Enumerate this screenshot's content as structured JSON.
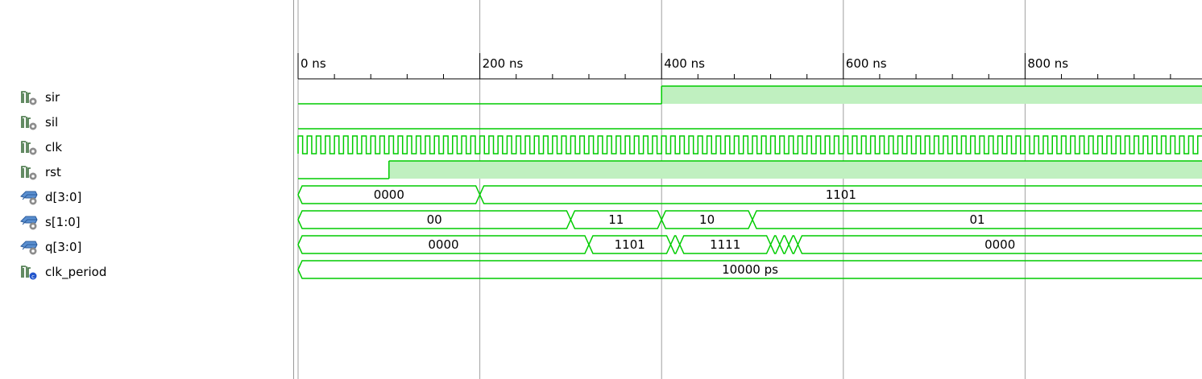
{
  "signals": [
    {
      "name": "sir",
      "icon": "scalar-signal-icon"
    },
    {
      "name": "sil",
      "icon": "scalar-signal-icon"
    },
    {
      "name": "clk",
      "icon": "scalar-signal-icon"
    },
    {
      "name": "rst",
      "icon": "scalar-signal-icon"
    },
    {
      "name": "d[3:0]",
      "icon": "bus-signal-icon"
    },
    {
      "name": "s[1:0]",
      "icon": "bus-signal-icon"
    },
    {
      "name": "q[3:0]",
      "icon": "bus-signal-icon"
    },
    {
      "name": "clk_period",
      "icon": "constant-signal-icon"
    }
  ],
  "timeline": {
    "unit": "ns",
    "visible_end_ns": 1000,
    "major_ticks": [
      "0 ns",
      "200 ns",
      "400 ns",
      "600 ns",
      "800 ns"
    ],
    "major_ns": [
      0,
      200,
      400,
      600,
      800
    ],
    "minor_step_ns": 40
  },
  "waves": {
    "sir": {
      "type": "bit",
      "segments": [
        {
          "from": 0,
          "to": 400,
          "value": 0
        },
        {
          "from": 400,
          "to": 1000,
          "value": 1
        }
      ]
    },
    "sil": {
      "type": "bit",
      "segments": [
        {
          "from": 0,
          "to": 1000,
          "value": 0
        }
      ]
    },
    "clk": {
      "type": "clock",
      "period_ns": 10
    },
    "rst": {
      "type": "bit",
      "segments": [
        {
          "from": 0,
          "to": 100,
          "value": 0
        },
        {
          "from": 100,
          "to": 1000,
          "value": 1
        }
      ]
    },
    "d": {
      "type": "bus",
      "segments": [
        {
          "from": 0,
          "to": 200,
          "label": "0000"
        },
        {
          "from": 200,
          "to": 1000,
          "label": "1101"
        }
      ]
    },
    "s": {
      "type": "bus",
      "segments": [
        {
          "from": 0,
          "to": 300,
          "label": "00"
        },
        {
          "from": 300,
          "to": 400,
          "label": "11"
        },
        {
          "from": 400,
          "to": 500,
          "label": "10"
        },
        {
          "from": 500,
          "to": 1000,
          "label": "01"
        }
      ]
    },
    "q": {
      "type": "bus",
      "segments": [
        {
          "from": 0,
          "to": 320,
          "label": "0000"
        },
        {
          "from": 320,
          "to": 410,
          "label": "1101"
        },
        {
          "from": 410,
          "to": 420,
          "label": ""
        },
        {
          "from": 420,
          "to": 520,
          "label": "1111"
        },
        {
          "from": 520,
          "to": 530,
          "label": ""
        },
        {
          "from": 530,
          "to": 540,
          "label": ""
        },
        {
          "from": 540,
          "to": 550,
          "label": ""
        },
        {
          "from": 550,
          "to": 1000,
          "label": "0000"
        }
      ]
    },
    "clk_period": {
      "type": "bus",
      "segments": [
        {
          "from": 0,
          "to": 1000,
          "label": "10000 ps"
        }
      ]
    }
  },
  "colors": {
    "wave": "#00cc00",
    "high_fill": "#c0f0c0",
    "grid": "#a0a0a0",
    "axis": "#000000"
  }
}
